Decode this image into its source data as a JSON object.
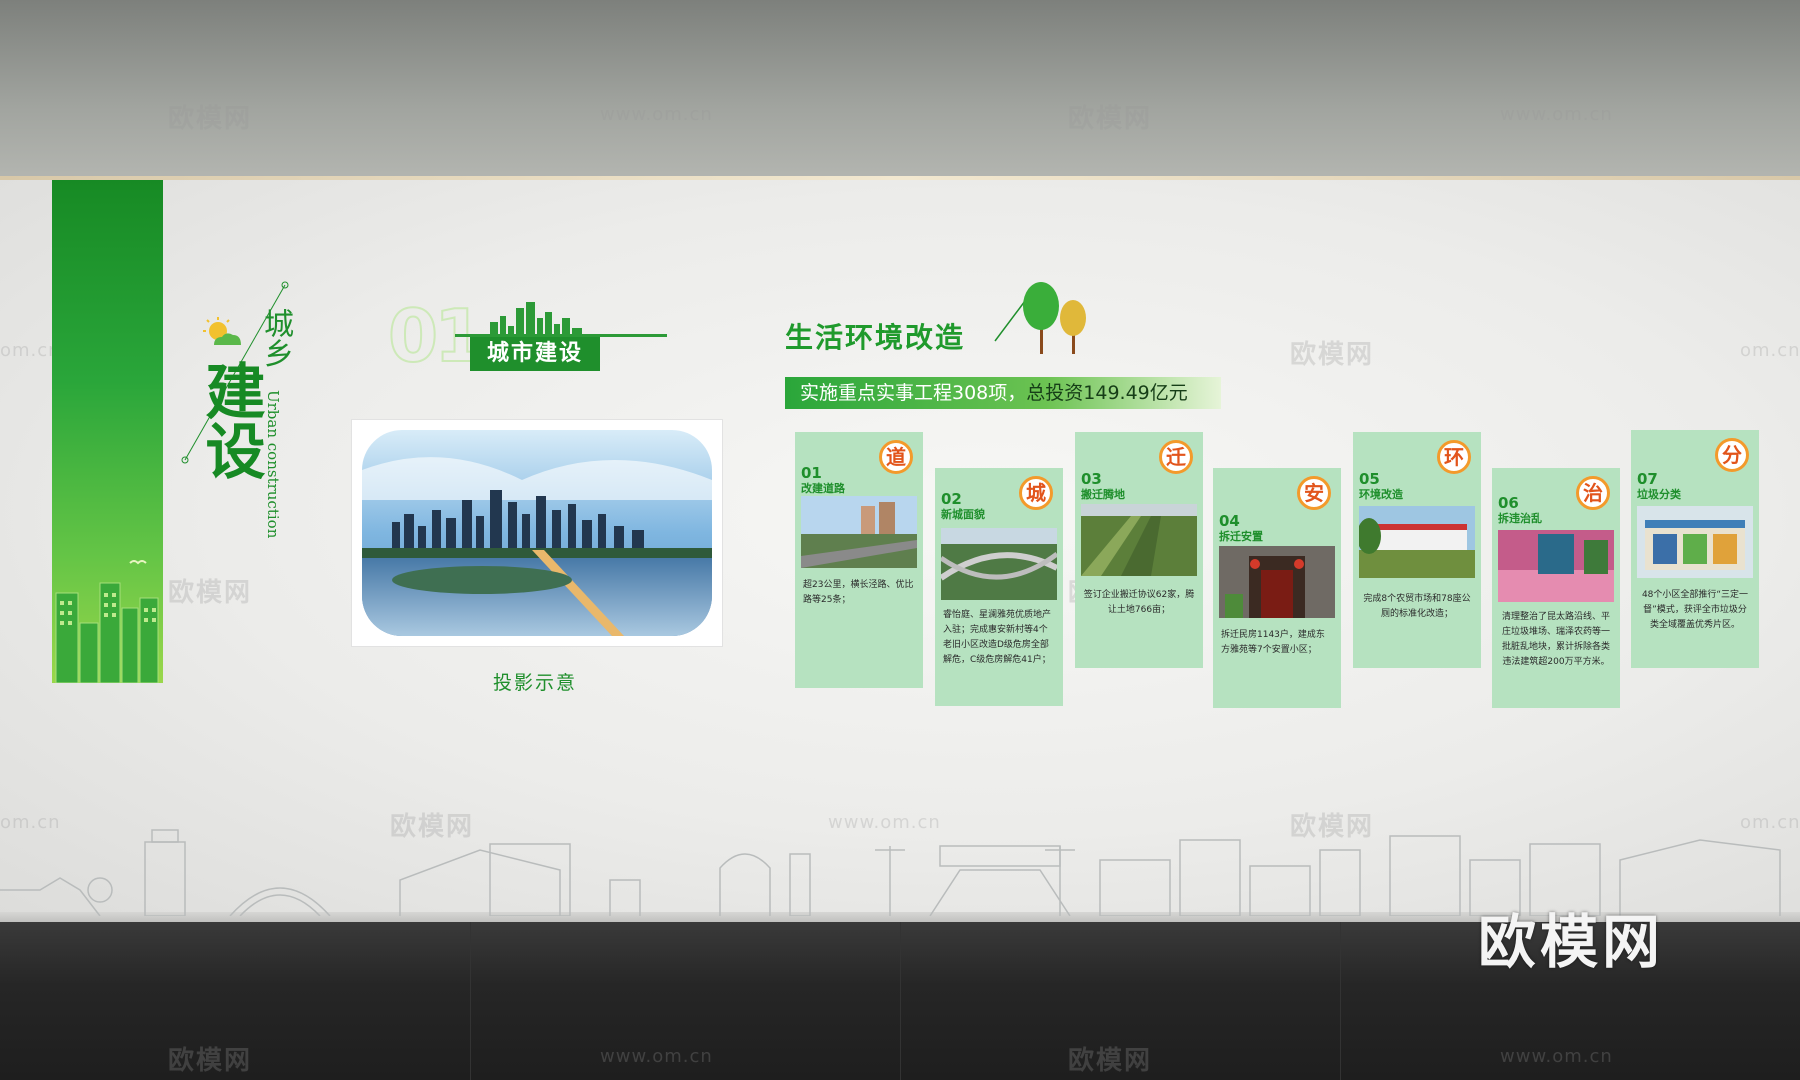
{
  "watermarks": {
    "brand": "欧模网",
    "url": "www.om.cn",
    "url_short": "om.cn"
  },
  "left_panel": {
    "title_small": "城乡",
    "title_large": "建设",
    "title_english": "Urban construction"
  },
  "section": {
    "number": "01",
    "title": "城市建设",
    "projection_caption": "投影示意"
  },
  "life": {
    "title": "生活环境改造",
    "bar_prefix": "实施重点实事工程308项，",
    "bar_suffix": "总投资149.49亿元"
  },
  "cards": [
    {
      "num": "01",
      "label": "改建道路",
      "badge": "道",
      "desc": "超23公里，横长泾路、优比路等25条；"
    },
    {
      "num": "02",
      "label": "新城面貌",
      "badge": "城",
      "desc": "睿怡庭、星澜雅苑优质地产入驻；完成惠安新村等4个老旧小区改造D级危房全部解危，C级危房解危41户；"
    },
    {
      "num": "03",
      "label": "搬迁腾地",
      "badge": "迁",
      "desc": "签订企业搬迁协议62家，腾让土地766亩；"
    },
    {
      "num": "04",
      "label": "拆迁安置",
      "badge": "安",
      "desc": "拆迁民房1143户，建成东方雅苑等7个安置小区；"
    },
    {
      "num": "05",
      "label": "环境改造",
      "badge": "环",
      "desc": "完成8个农贸市场和78座公厕的标准化改造；"
    },
    {
      "num": "06",
      "label": "拆违治乱",
      "badge": "治",
      "desc": "清理整治了昆太路沿线、平庄垃圾堆场、瑞泽农药等一批脏乱地块，累计拆除各类违法建筑超200万平方米。"
    },
    {
      "num": "07",
      "label": "垃圾分类",
      "badge": "分",
      "desc": "48个小区全部推行“三定一督”模式，获评全市垃圾分类全域覆盖优秀片区。"
    }
  ],
  "colors": {
    "primary_green": "#1f8f2c",
    "card_green": "#b6e2c0",
    "badge_orange": "#f39a2b"
  }
}
